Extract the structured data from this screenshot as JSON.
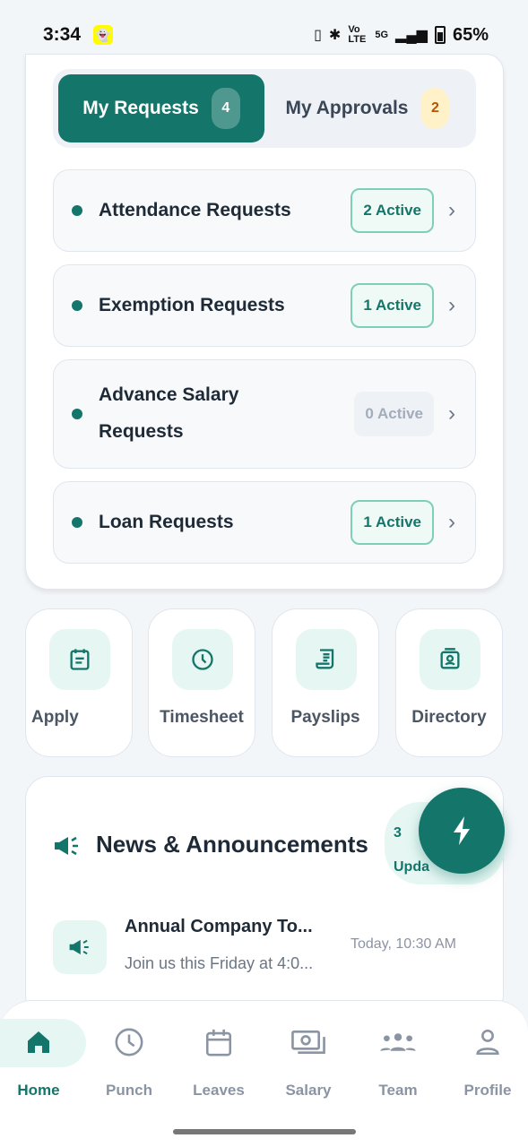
{
  "status_bar": {
    "time": "3:34",
    "battery": "65%",
    "network": "5G",
    "volte": "Vo LTE"
  },
  "requests": {
    "tabs": [
      {
        "label": "My Requests",
        "count": "4",
        "active": true
      },
      {
        "label": "My Approvals",
        "count": "2",
        "active": false
      }
    ],
    "items": [
      {
        "label": "Attendance Requests",
        "badge": "2 Active",
        "state": "on"
      },
      {
        "label": "Exemption Requests",
        "badge": "1 Active",
        "state": "on"
      },
      {
        "label": "Advance Salary Requests",
        "badge": "0 Active",
        "state": "off"
      },
      {
        "label": "Loan Requests",
        "badge": "1 Active",
        "state": "on"
      }
    ]
  },
  "quick_actions": [
    {
      "label": "Apply",
      "icon": "apply-icon"
    },
    {
      "label": "Timesheet",
      "icon": "clock-icon"
    },
    {
      "label": "Payslips",
      "icon": "payslip-icon"
    },
    {
      "label": "Directory",
      "icon": "directory-icon"
    }
  ],
  "news": {
    "title": "News & Announcements",
    "updates_count": "3",
    "updates_label": "Upda",
    "item": {
      "title": "Annual Company To...",
      "description": "Join us this Friday at 4:0...",
      "time": "Today, 10:30 AM"
    }
  },
  "bottom_nav": [
    {
      "label": "Home",
      "icon": "home-icon",
      "active": true
    },
    {
      "label": "Punch",
      "icon": "clock-icon",
      "active": false
    },
    {
      "label": "Leaves",
      "icon": "calendar-icon",
      "active": false
    },
    {
      "label": "Salary",
      "icon": "money-icon",
      "active": false
    },
    {
      "label": "Team",
      "icon": "team-icon",
      "active": false
    },
    {
      "label": "Profile",
      "icon": "person-icon",
      "active": false
    }
  ],
  "colors": {
    "accent": "#14766a",
    "accent_light": "#e6f7f3",
    "approval_badge": "#fff2c8"
  }
}
